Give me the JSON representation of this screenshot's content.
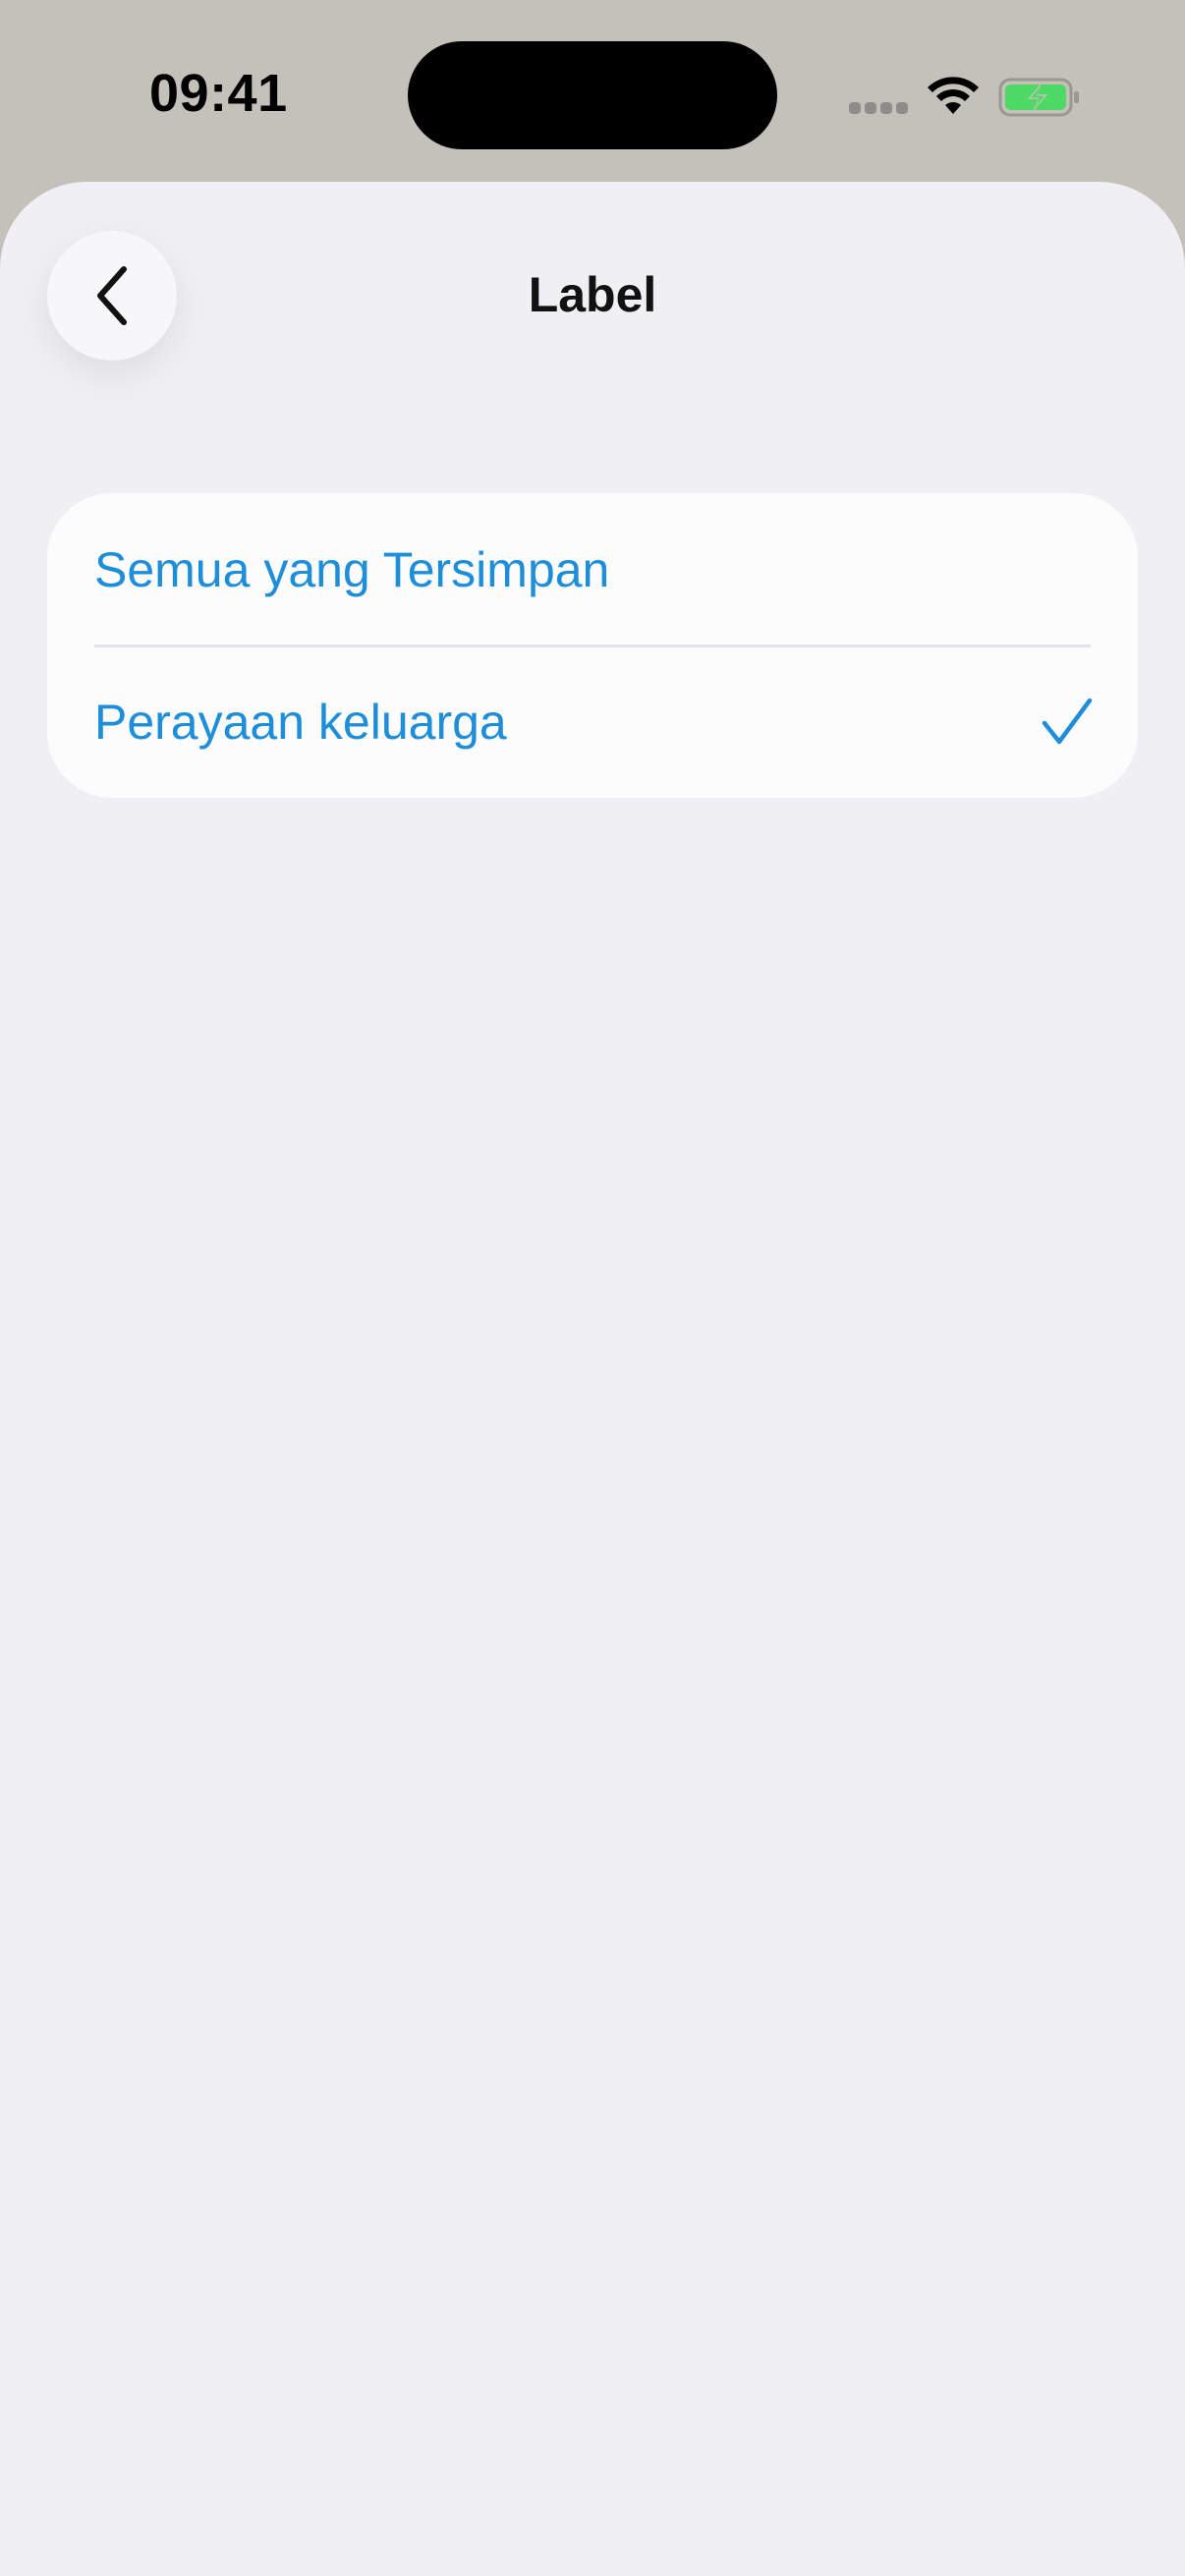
{
  "status_bar": {
    "time": "09:41"
  },
  "nav": {
    "title": "Label",
    "back_icon": "chevron-left-icon"
  },
  "list": {
    "items": [
      {
        "label": "Semua yang Tersimpan",
        "selected": false
      },
      {
        "label": "Perayaan keluarga",
        "selected": true
      }
    ]
  },
  "colors": {
    "accent": "#1f8ed8",
    "sheet_background": "#efeff4",
    "card_background": "#fcfcfd",
    "status_background": "#c4c1ba",
    "battery_fill": "#4cd964"
  }
}
